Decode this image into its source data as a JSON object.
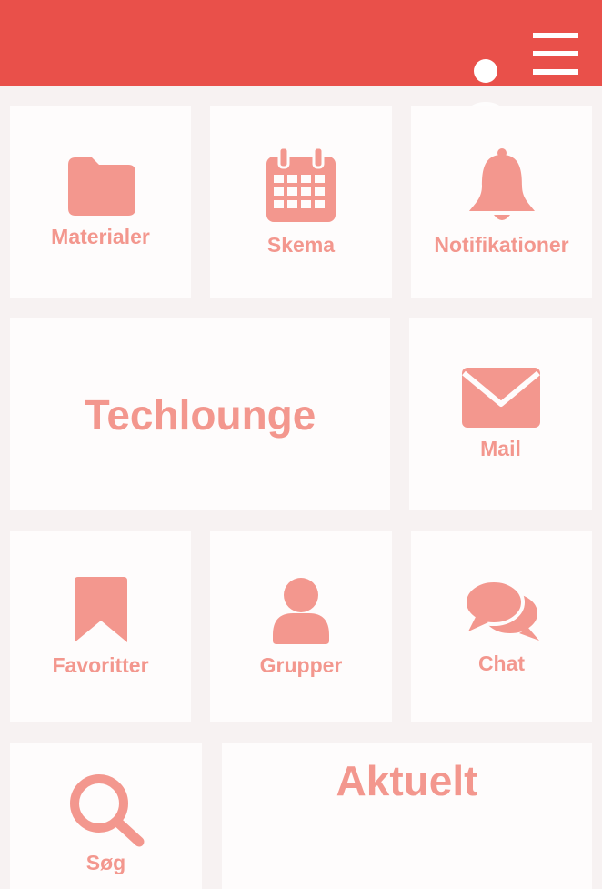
{
  "colors": {
    "header": "#e9504a",
    "accent": "#f3978e",
    "tile": "#fefcfc",
    "background": "#f7f2f2"
  },
  "header": {
    "menu_icon": "hamburger-menu-icon",
    "profile_icon": "user-profile-icon"
  },
  "tiles": {
    "materialer": {
      "label": "Materialer",
      "icon": "folder-icon"
    },
    "skema": {
      "label": "Skema",
      "icon": "calendar-icon"
    },
    "notifikationer": {
      "label": "Notifikationer",
      "icon": "bell-icon"
    },
    "techlounge": {
      "label": "Techlounge"
    },
    "mail": {
      "label": "Mail",
      "icon": "envelope-icon"
    },
    "favoritter": {
      "label": "Favoritter",
      "icon": "bookmark-icon"
    },
    "grupper": {
      "label": "Grupper",
      "icon": "person-icon"
    },
    "chat": {
      "label": "Chat",
      "icon": "chat-bubbles-icon"
    },
    "soeg": {
      "label": "Søg",
      "icon": "search-icon"
    },
    "aktuelt": {
      "label": "Aktuelt"
    }
  }
}
